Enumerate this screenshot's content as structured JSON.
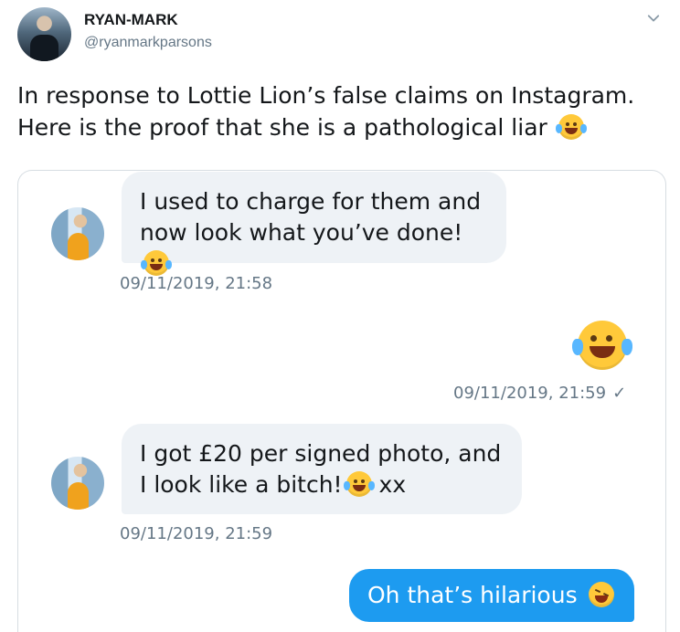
{
  "tweet": {
    "author_name": "RYAN-MARK",
    "author_handle": "@ryanmarkparsons",
    "line_1": "In response to Lottie Lion’s false claims on Instagram.",
    "line_2": "Here is the proof that she is a pathological liar"
  },
  "icons": {
    "profile_avatar": "avatar",
    "more_options": "chevron-down-icon",
    "laughing_tears": "face-with-tears-of-joy-emoji",
    "grinning_squint": "grinning-squinting-face-emoji",
    "read_receipt": "checkmark-icon"
  },
  "chat": {
    "messages": [
      {
        "side": "received",
        "lines": [
          "I used to charge for them and",
          "now look what you’ve done!"
        ],
        "time": "09/11/2019, 21:58"
      },
      {
        "side": "sent",
        "time": "09/11/2019, 21:59",
        "check": "✓"
      },
      {
        "side": "received",
        "lines": [
          "I got £20 per signed photo, and",
          "I look like a bitch!"
        ],
        "suffix": " xx",
        "time": "09/11/2019, 21:59"
      },
      {
        "side": "sent",
        "text": "Oh that’s hilarious"
      }
    ]
  },
  "colors": {
    "sent_bubble": "#1d9bf0",
    "received_bubble": "#eef2f6",
    "muted_text": "#657786"
  }
}
